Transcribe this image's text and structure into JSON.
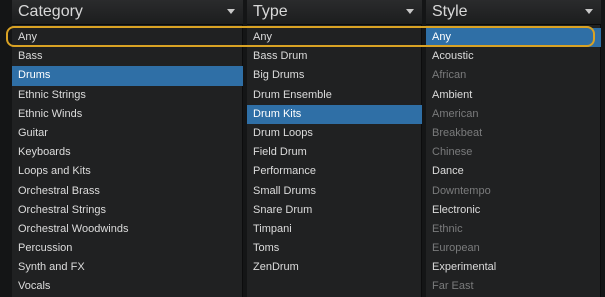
{
  "columns": [
    {
      "header": "Category",
      "items": [
        {
          "label": "Any",
          "state": "normal"
        },
        {
          "label": "Bass",
          "state": "normal"
        },
        {
          "label": "Drums",
          "state": "selected"
        },
        {
          "label": "Ethnic Strings",
          "state": "normal"
        },
        {
          "label": "Ethnic Winds",
          "state": "normal"
        },
        {
          "label": "Guitar",
          "state": "normal"
        },
        {
          "label": "Keyboards",
          "state": "normal"
        },
        {
          "label": "Loops and Kits",
          "state": "normal"
        },
        {
          "label": "Orchestral Brass",
          "state": "normal"
        },
        {
          "label": "Orchestral Strings",
          "state": "normal"
        },
        {
          "label": "Orchestral Woodwinds",
          "state": "normal"
        },
        {
          "label": "Percussion",
          "state": "normal"
        },
        {
          "label": "Synth and FX",
          "state": "normal"
        },
        {
          "label": "Vocals",
          "state": "normal"
        }
      ]
    },
    {
      "header": "Type",
      "items": [
        {
          "label": "Any",
          "state": "normal"
        },
        {
          "label": "Bass Drum",
          "state": "normal"
        },
        {
          "label": "Big Drums",
          "state": "normal"
        },
        {
          "label": "Drum Ensemble",
          "state": "normal"
        },
        {
          "label": "Drum Kits",
          "state": "selected"
        },
        {
          "label": "Drum Loops",
          "state": "normal"
        },
        {
          "label": "Field Drum",
          "state": "normal"
        },
        {
          "label": "Performance",
          "state": "normal"
        },
        {
          "label": "Small Drums",
          "state": "normal"
        },
        {
          "label": "Snare Drum",
          "state": "normal"
        },
        {
          "label": "Timpani",
          "state": "normal"
        },
        {
          "label": "Toms",
          "state": "normal"
        },
        {
          "label": "ZenDrum",
          "state": "normal"
        }
      ]
    },
    {
      "header": "Style",
      "items": [
        {
          "label": "Any",
          "state": "selected"
        },
        {
          "label": "Acoustic",
          "state": "normal"
        },
        {
          "label": "African",
          "state": "disabled"
        },
        {
          "label": "Ambient",
          "state": "normal"
        },
        {
          "label": "American",
          "state": "disabled"
        },
        {
          "label": "Breakbeat",
          "state": "disabled"
        },
        {
          "label": "Chinese",
          "state": "disabled"
        },
        {
          "label": "Dance",
          "state": "normal"
        },
        {
          "label": "Downtempo",
          "state": "disabled"
        },
        {
          "label": "Electronic",
          "state": "normal"
        },
        {
          "label": "Ethnic",
          "state": "disabled"
        },
        {
          "label": "European",
          "state": "disabled"
        },
        {
          "label": "Experimental",
          "state": "normal"
        },
        {
          "label": "Far East",
          "state": "disabled"
        }
      ]
    }
  ],
  "colors": {
    "selection": "#2f6fa6",
    "highlight_ring": "#d9a224",
    "text": "#dcdcdc",
    "disabled_text": "#7a7b7c"
  },
  "icons": {
    "header_dropdown": "chevron-down-icon"
  }
}
